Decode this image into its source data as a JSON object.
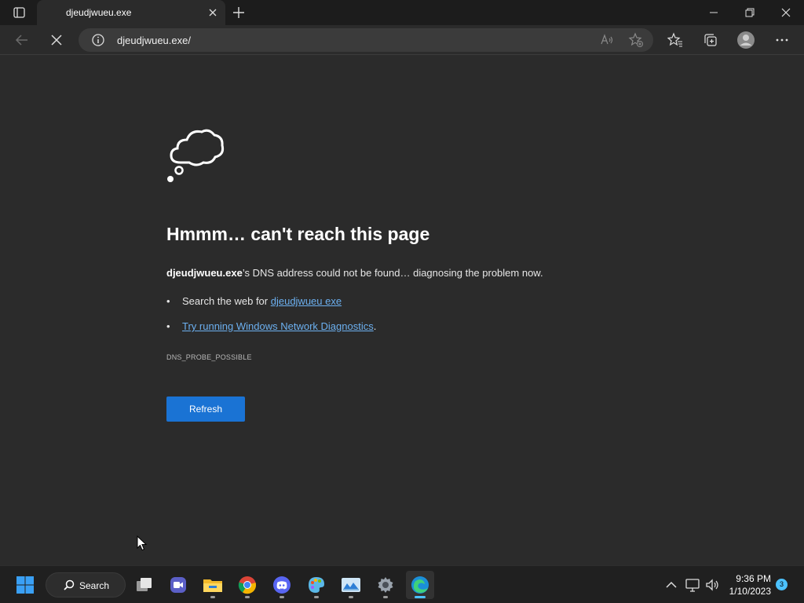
{
  "browser": {
    "tab": {
      "title": "djeudjwueu.exe"
    },
    "address_bar": {
      "url": "djeudjwueu.exe/"
    }
  },
  "error_page": {
    "title": "Hmmm… can't reach this page",
    "host": "djeudjwueu.exe",
    "description_rest": "’s DNS address could not be found… diagnosing the problem now.",
    "suggestion_search_prefix": "Search the web for ",
    "suggestion_search_link": "djeudjwueu exe",
    "suggestion_diag_link": "Try running Windows Network Diagnostics",
    "suggestion_diag_suffix": ".",
    "error_code": "DNS_PROBE_POSSIBLE",
    "refresh_label": "Refresh"
  },
  "taskbar": {
    "search_label": "Search",
    "apps": [
      "start-icon",
      "task-view-icon",
      "video-call-icon",
      "file-explorer-icon",
      "chrome-icon",
      "discord-icon",
      "paint-icon",
      "photos-icon",
      "settings-icon",
      "edge-icon"
    ],
    "clock": {
      "time": "9:36 PM",
      "date": "1/10/2023"
    },
    "notification_count": "3"
  },
  "colors": {
    "accent": "#1a73d4",
    "link": "#6cb0f0",
    "taskbar_indicator": "#4cc2ff"
  }
}
